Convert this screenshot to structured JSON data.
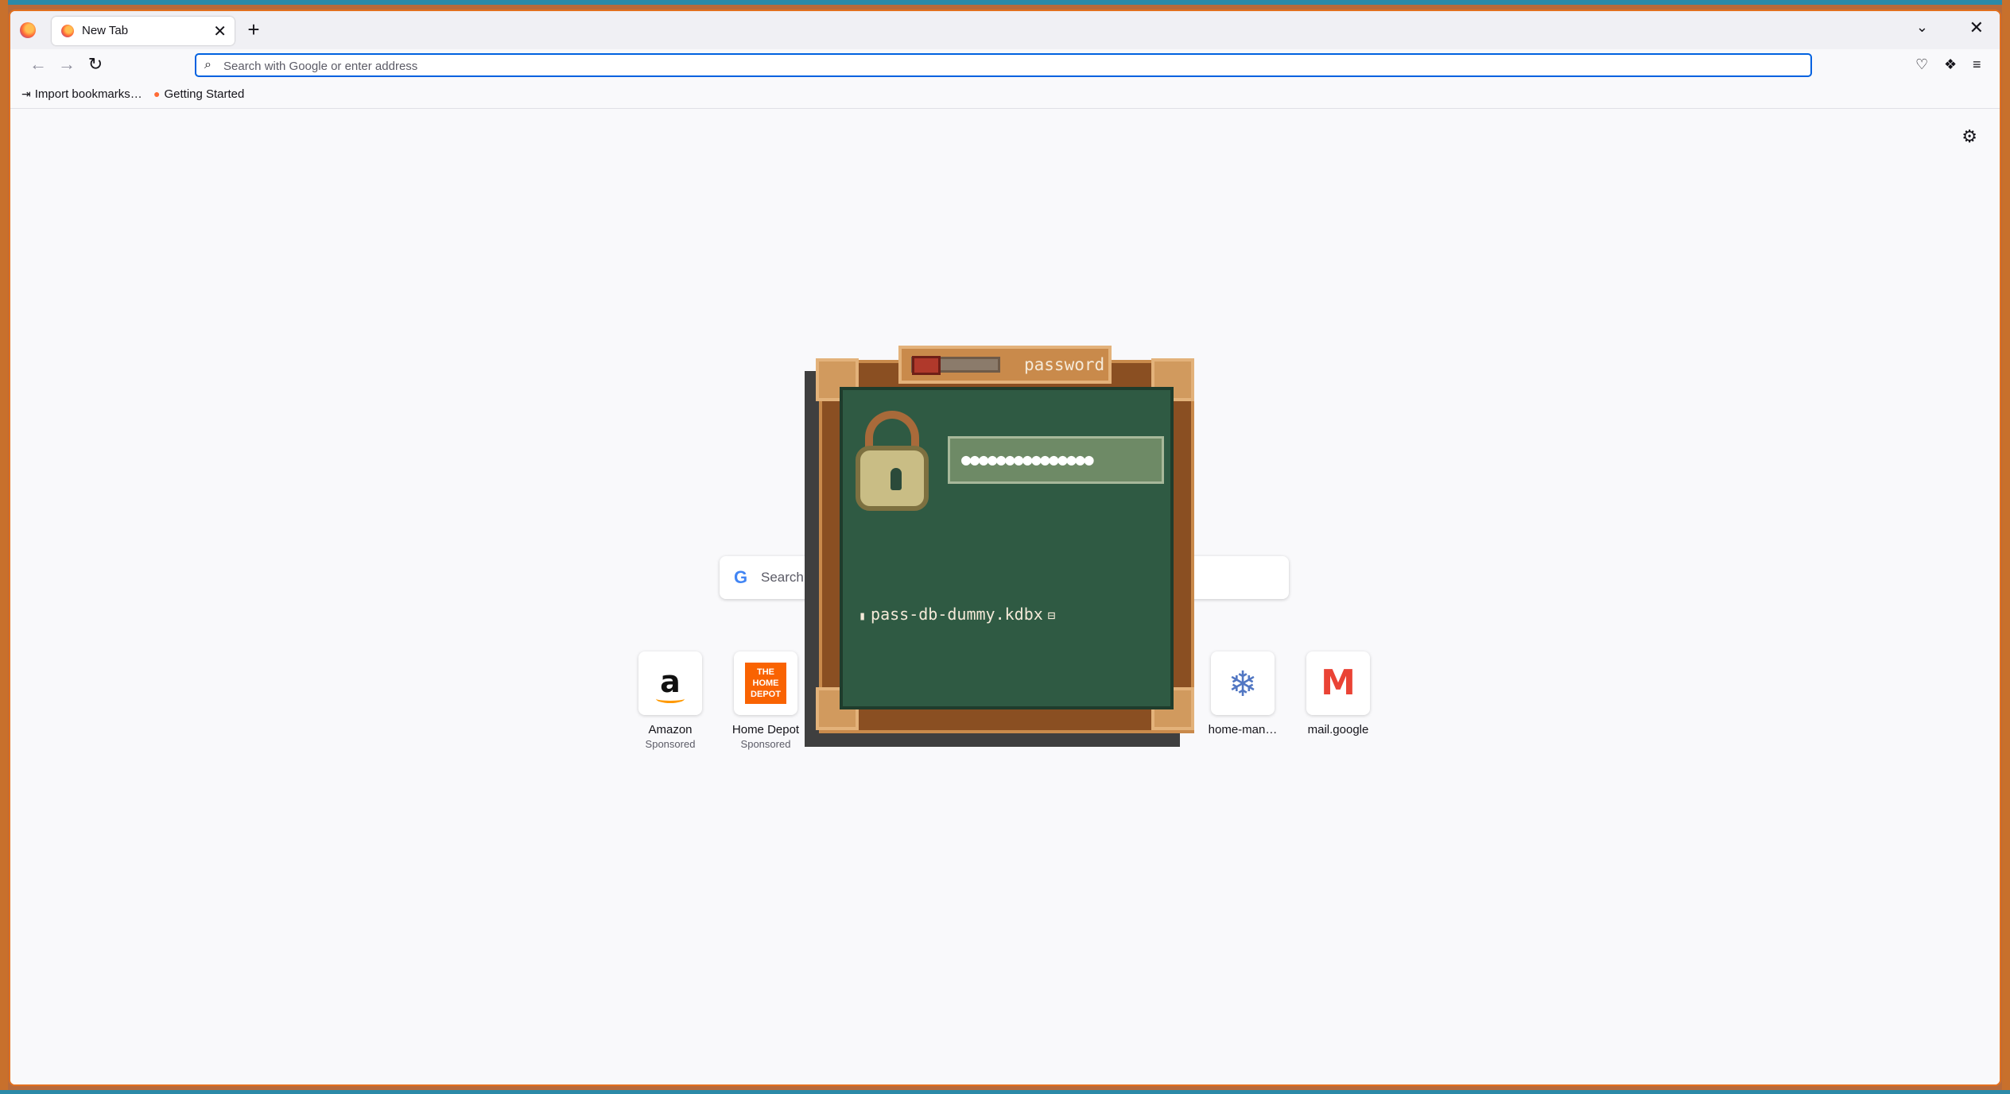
{
  "browser": {
    "tab": {
      "title": "New Tab",
      "close_glyph": "✕"
    },
    "new_tab_glyph": "+",
    "list_tabs_glyph": "⌄",
    "window_close_glyph": "✕",
    "nav": {
      "back_glyph": "←",
      "forward_glyph": "→",
      "reload_glyph": "↻"
    },
    "urlbar": {
      "placeholder": "Search with Google or enter address",
      "value": ""
    },
    "toolbar_icons": [
      "pocket-icon",
      "extensions-icon",
      "menu-icon"
    ],
    "bookmarks": [
      {
        "label": "Import bookmarks…",
        "icon": "import-icon"
      },
      {
        "label": "Getting Started",
        "icon": "firefox-icon"
      }
    ]
  },
  "newtab": {
    "settings_glyph": "⚙",
    "search_placeholder": "Search wi",
    "search_engine_glyph": "G",
    "shortcuts": [
      {
        "name": "Amazon",
        "sponsored": "Sponsored",
        "logo": "a"
      },
      {
        "name": "Home Depot",
        "sponsored": "Sponsored",
        "logo": "THE HOME DEPOT"
      },
      {
        "name": "home-man…",
        "sponsored": "",
        "logo": "❄"
      },
      {
        "name": "mail.google",
        "sponsored": "",
        "logo": "M"
      }
    ]
  },
  "password_dialog": {
    "title": "password",
    "masked_value": "●●●●●●●●●●●●●●●",
    "file_name": "pass-db-dummy.kdbx",
    "file_icon": "▮",
    "folder_icon": "⊟"
  },
  "colors": {
    "accent": "#0061e0",
    "window_border": "#e2701f",
    "dialog_board": "#2f5a43",
    "dialog_wood": "#8a4f22"
  }
}
